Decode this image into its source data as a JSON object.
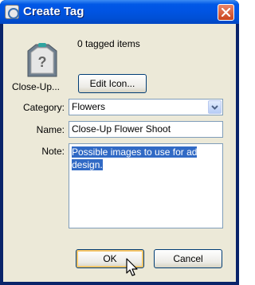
{
  "window": {
    "title": "Create Tag"
  },
  "tag": {
    "name": "Close-Up...",
    "tagged_count": "0 tagged items",
    "edit_icon_label": "Edit Icon..."
  },
  "form": {
    "category_label": "Category:",
    "category_value": "Flowers",
    "name_label": "Name:",
    "name_value": "Close-Up Flower Shoot",
    "note_label": "Note:",
    "note_value": "Possible images to use for ad design."
  },
  "buttons": {
    "ok": "OK",
    "cancel": "Cancel"
  }
}
